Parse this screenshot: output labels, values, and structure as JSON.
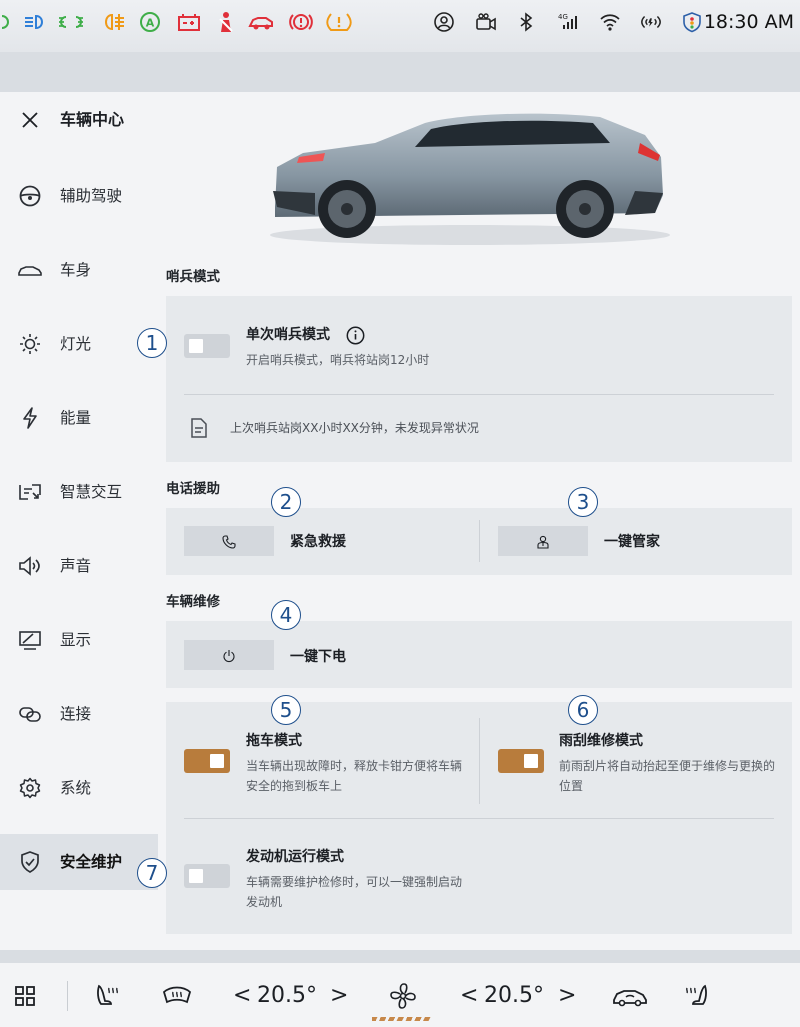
{
  "status_bar": {
    "telltales": [
      {
        "icon": "position-light-icon",
        "color": "#3fae49"
      },
      {
        "icon": "low-beam-icon",
        "color": "#2f7fd8"
      },
      {
        "icon": "side-light-icon",
        "color": "#3fae49"
      },
      {
        "icon": "rear-fog-light-icon",
        "color": "#f09a16"
      },
      {
        "icon": "auto-hold-icon",
        "color": "#3fae49"
      },
      {
        "icon": "battery-warning-icon",
        "color": "#e0303a"
      },
      {
        "icon": "seatbelt-warning-icon",
        "color": "#e0303a"
      },
      {
        "icon": "vehicle-fault-icon",
        "color": "#e0303a"
      },
      {
        "icon": "brake-warning-icon",
        "color": "#e0303a"
      },
      {
        "icon": "tire-pressure-warning-icon",
        "color": "#f09a16"
      }
    ],
    "system_icons": [
      "user-profile-icon",
      "dashcam-icon",
      "bluetooth-icon",
      "4g-signal-icon",
      "wifi-icon",
      "hotspot-icon",
      "security-shield-icon"
    ],
    "signal_label": "4G",
    "time": "18:30 AM"
  },
  "header": {
    "title": "车辆中心",
    "close_icon": "close-icon"
  },
  "sidebar": {
    "items": [
      {
        "label": "辅助驾驶",
        "icon": "steering-wheel-icon"
      },
      {
        "label": "车身",
        "icon": "car-body-icon"
      },
      {
        "label": "灯光",
        "icon": "sun-light-icon"
      },
      {
        "label": "能量",
        "icon": "lightning-icon"
      },
      {
        "label": "智慧交互",
        "icon": "smart-interaction-icon"
      },
      {
        "label": "声音",
        "icon": "speaker-icon"
      },
      {
        "label": "显示",
        "icon": "display-icon"
      },
      {
        "label": "连接",
        "icon": "link-icon"
      },
      {
        "label": "系统",
        "icon": "gear-icon"
      },
      {
        "label": "安全维护",
        "icon": "shield-check-icon",
        "active": true
      }
    ]
  },
  "sentry": {
    "section_title": "哨兵模式",
    "single_sentry": {
      "title": "单次哨兵模式",
      "description": "开启哨兵模式，哨兵将站岗12小时",
      "enabled": false,
      "info_icon": "info-icon"
    },
    "last_record": {
      "text": "上次哨兵站岗XX小时XX分钟，未发现异常状况",
      "icon": "document-icon"
    }
  },
  "phone_assist": {
    "section_title": "电话援助",
    "buttons": [
      {
        "label": "紧急救援",
        "icon": "phone-icon"
      },
      {
        "label": "一键管家",
        "icon": "butler-icon"
      }
    ]
  },
  "maintenance": {
    "section_title": "车辆维修",
    "power_off": {
      "label": "一键下电",
      "icon": "power-icon"
    },
    "tow_mode": {
      "title": "拖车模式",
      "description": "当车辆出现故障时，释放卡钳方便将车辆  安全的拖到板车上",
      "enabled": true
    },
    "wiper_mode": {
      "title": "雨刮维修模式",
      "description": "前雨刮片将自动抬起至便于维修与更换的位置",
      "enabled": true
    },
    "engine_mode": {
      "title": "发动机运行模式",
      "description": "车辆需要维护检修时，可以一键强制启动发动机",
      "enabled": false
    }
  },
  "annotation_markers": [
    "1",
    "2",
    "3",
    "4",
    "5",
    "6",
    "7"
  ],
  "bottom_bar": {
    "left_temp": "20.5°",
    "right_temp": "20.5°",
    "chevron_left": "<",
    "chevron_right": ">",
    "icons": [
      "app-grid-icon",
      "driver-seat-heat-icon",
      "front-defrost-icon",
      "fan-icon",
      "car-climate-icon",
      "passenger-seat-heat-icon"
    ]
  },
  "colors": {
    "accent_toggle": "#b87c3c",
    "marker_blue": "#1e4f8c",
    "panel_bg": "#f3f4f6",
    "card_bg": "#e6e9ec"
  }
}
